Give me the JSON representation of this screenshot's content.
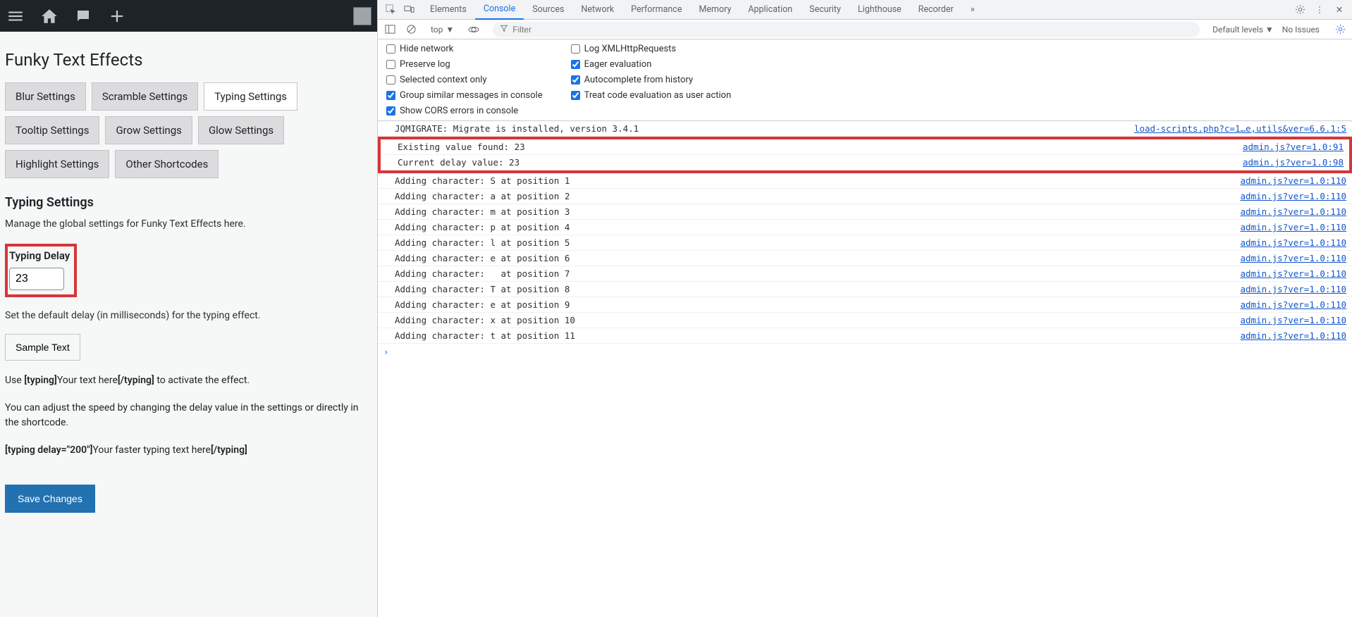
{
  "wp": {
    "page_title": "Funky Text Effects",
    "tabs": [
      "Blur Settings",
      "Scramble Settings",
      "Typing Settings",
      "Tooltip Settings",
      "Grow Settings",
      "Glow Settings",
      "Highlight Settings",
      "Other Shortcodes"
    ],
    "active_tab_index": 2,
    "section_heading": "Typing Settings",
    "section_desc": "Manage the global settings for Funky Text Effects here.",
    "field_label": "Typing Delay",
    "field_value": "23",
    "field_help": "Set the default delay (in milliseconds) for the typing effect.",
    "sample_button": "Sample Text",
    "usage_prefix": "Use ",
    "usage_open": "[typing]",
    "usage_mid": "Your text here",
    "usage_close": "[/typing]",
    "usage_suffix": " to activate the effect.",
    "adjust_text": "You can adjust the speed by changing the delay value in the settings or directly in the shortcode.",
    "ex_open": "[typing delay=\"200\"]",
    "ex_mid": "Your faster typing text here",
    "ex_close": "[/typing]",
    "save_button": "Save Changes"
  },
  "devtools": {
    "tabs": [
      "Elements",
      "Console",
      "Sources",
      "Network",
      "Performance",
      "Memory",
      "Application",
      "Security",
      "Lighthouse",
      "Recorder"
    ],
    "active_tab_index": 1,
    "context": "top",
    "filter_placeholder": "Filter",
    "levels": "Default levels",
    "issues": "No Issues",
    "settings_left": [
      {
        "label": "Hide network",
        "checked": false
      },
      {
        "label": "Preserve log",
        "checked": false
      },
      {
        "label": "Selected context only",
        "checked": false
      },
      {
        "label": "Group similar messages in console",
        "checked": true
      },
      {
        "label": "Show CORS errors in console",
        "checked": true
      }
    ],
    "settings_right": [
      {
        "label": "Log XMLHttpRequests",
        "checked": false
      },
      {
        "label": "Eager evaluation",
        "checked": true
      },
      {
        "label": "Autocomplete from history",
        "checked": true
      },
      {
        "label": "Treat code evaluation as user action",
        "checked": true
      }
    ],
    "log_first": {
      "msg": "JQMIGRATE: Migrate is installed, version 3.4.1",
      "src": "load-scripts.php?c=1…e,utils&ver=6.6.1:5"
    },
    "log_highlighted": [
      {
        "msg": "Existing value found: 23",
        "src": "admin.js?ver=1.0:91"
      },
      {
        "msg": "Current delay value: 23",
        "src": "admin.js?ver=1.0:98"
      }
    ],
    "log_rest": [
      {
        "msg": "Adding character: S at position 1",
        "src": "admin.js?ver=1.0:110"
      },
      {
        "msg": "Adding character: a at position 2",
        "src": "admin.js?ver=1.0:110"
      },
      {
        "msg": "Adding character: m at position 3",
        "src": "admin.js?ver=1.0:110"
      },
      {
        "msg": "Adding character: p at position 4",
        "src": "admin.js?ver=1.0:110"
      },
      {
        "msg": "Adding character: l at position 5",
        "src": "admin.js?ver=1.0:110"
      },
      {
        "msg": "Adding character: e at position 6",
        "src": "admin.js?ver=1.0:110"
      },
      {
        "msg": "Adding character:   at position 7",
        "src": "admin.js?ver=1.0:110"
      },
      {
        "msg": "Adding character: T at position 8",
        "src": "admin.js?ver=1.0:110"
      },
      {
        "msg": "Adding character: e at position 9",
        "src": "admin.js?ver=1.0:110"
      },
      {
        "msg": "Adding character: x at position 10",
        "src": "admin.js?ver=1.0:110"
      },
      {
        "msg": "Adding character: t at position 11",
        "src": "admin.js?ver=1.0:110"
      }
    ]
  }
}
